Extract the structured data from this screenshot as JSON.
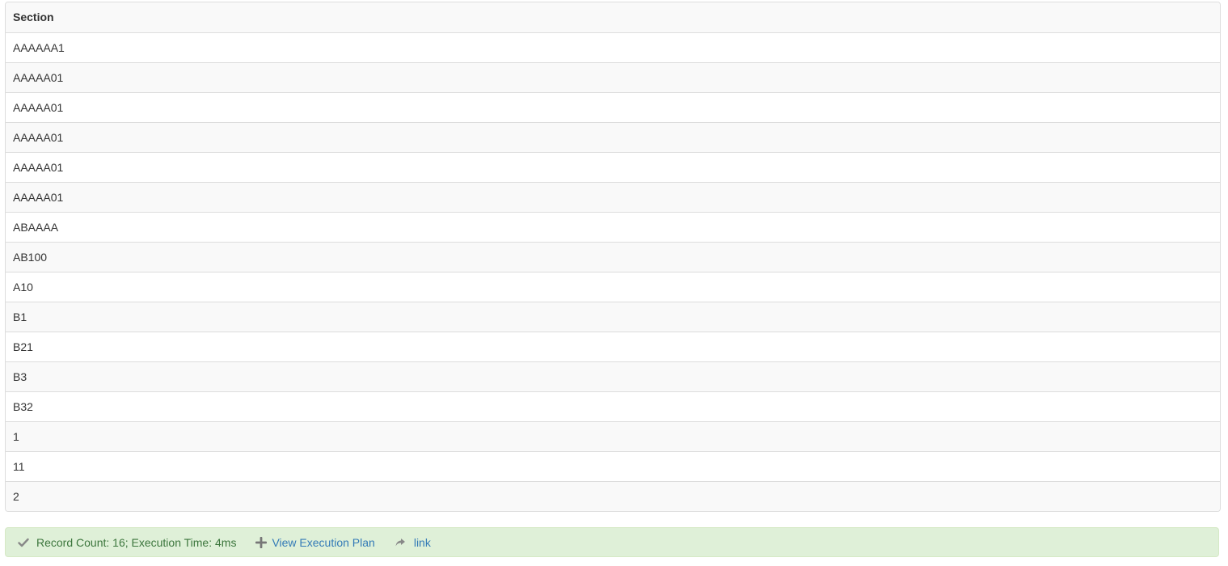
{
  "table": {
    "header": "Section",
    "rows": [
      "AAAAAA1",
      "AAAAA01",
      "AAAAA01",
      "AAAAA01",
      "AAAAA01",
      "AAAAA01",
      "ABAAAA",
      "AB100",
      "A10",
      "B1",
      "B21",
      "B3",
      "B32",
      "1",
      "11",
      "2"
    ]
  },
  "status": {
    "summary": "Record Count: 16; Execution Time: 4ms",
    "summary_icon": "check-icon",
    "view_plan_label": "View Execution Plan",
    "view_plan_icon": "plus-icon",
    "link_label": "link",
    "link_icon": "share-icon",
    "colors": {
      "success_bg": "#dff0d8",
      "success_text": "#3c763d",
      "link": "#337ab7"
    }
  }
}
